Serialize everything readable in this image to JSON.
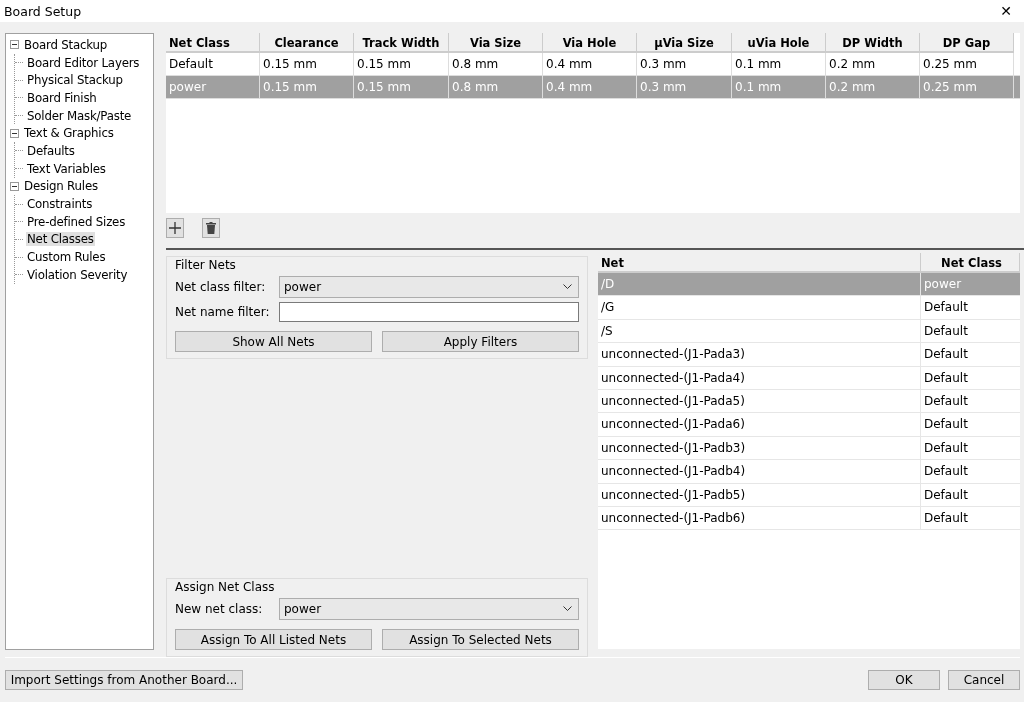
{
  "window": {
    "title": "Board Setup",
    "close": "✕"
  },
  "tree": [
    {
      "label": "Board Stackup",
      "expanded": true,
      "children": [
        {
          "label": "Board Editor Layers",
          "selected": false
        },
        {
          "label": "Physical Stackup",
          "selected": false
        },
        {
          "label": "Board Finish",
          "selected": false
        },
        {
          "label": "Solder Mask/Paste",
          "selected": false
        }
      ]
    },
    {
      "label": "Text & Graphics",
      "expanded": true,
      "children": [
        {
          "label": "Defaults",
          "selected": false
        },
        {
          "label": "Text Variables",
          "selected": false
        }
      ]
    },
    {
      "label": "Design Rules",
      "expanded": true,
      "children": [
        {
          "label": "Constraints",
          "selected": false
        },
        {
          "label": "Pre-defined Sizes",
          "selected": false
        },
        {
          "label": "Net Classes",
          "selected": true
        },
        {
          "label": "Custom Rules",
          "selected": false
        },
        {
          "label": "Violation Severity",
          "selected": false
        }
      ]
    }
  ],
  "net_classes": {
    "columns": [
      "Net Class",
      "Clearance",
      "Track Width",
      "Via Size",
      "Via Hole",
      "µVia Size",
      "uVia Hole",
      "DP Width",
      "DP Gap"
    ],
    "rows": [
      {
        "cells": [
          "Default",
          "0.15 mm",
          "0.15 mm",
          "0.8 mm",
          "0.4 mm",
          "0.3 mm",
          "0.1 mm",
          "0.2 mm",
          "0.25 mm"
        ],
        "selected": false
      },
      {
        "cells": [
          "power",
          "0.15 mm",
          "0.15 mm",
          "0.8 mm",
          "0.4 mm",
          "0.3 mm",
          "0.1 mm",
          "0.2 mm",
          "0.25 mm"
        ],
        "selected": true
      }
    ]
  },
  "filter_nets": {
    "title": "Filter Nets",
    "class_label": "Net class filter:",
    "class_value": "power",
    "name_label": "Net name filter:",
    "buttons": [
      "Show All Nets",
      "Apply Filters"
    ]
  },
  "assign": {
    "title": "Assign Net Class",
    "label": "New net class:",
    "value": "power",
    "buttons": [
      "Assign To All Listed Nets",
      "Assign To Selected Nets"
    ]
  },
  "nets": {
    "columns": [
      "Net",
      "Net Class"
    ],
    "rows": [
      {
        "net": "/D",
        "net_class": "power",
        "selected": true
      },
      {
        "net": "/G",
        "net_class": "Default",
        "selected": false
      },
      {
        "net": "/S",
        "net_class": "Default",
        "selected": false
      },
      {
        "net": "unconnected-(J1-Pada3)",
        "net_class": "Default",
        "selected": false
      },
      {
        "net": "unconnected-(J1-Pada4)",
        "net_class": "Default",
        "selected": false
      },
      {
        "net": "unconnected-(J1-Pada5)",
        "net_class": "Default",
        "selected": false
      },
      {
        "net": "unconnected-(J1-Pada6)",
        "net_class": "Default",
        "selected": false
      },
      {
        "net": "unconnected-(J1-Padb3)",
        "net_class": "Default",
        "selected": false
      },
      {
        "net": "unconnected-(J1-Padb4)",
        "net_class": "Default",
        "selected": false
      },
      {
        "net": "unconnected-(J1-Padb5)",
        "net_class": "Default",
        "selected": false
      },
      {
        "net": "unconnected-(J1-Padb6)",
        "net_class": "Default",
        "selected": false
      }
    ]
  },
  "footer": {
    "import": "Import Settings from Another Board...",
    "ok": "OK",
    "cancel": "Cancel"
  }
}
